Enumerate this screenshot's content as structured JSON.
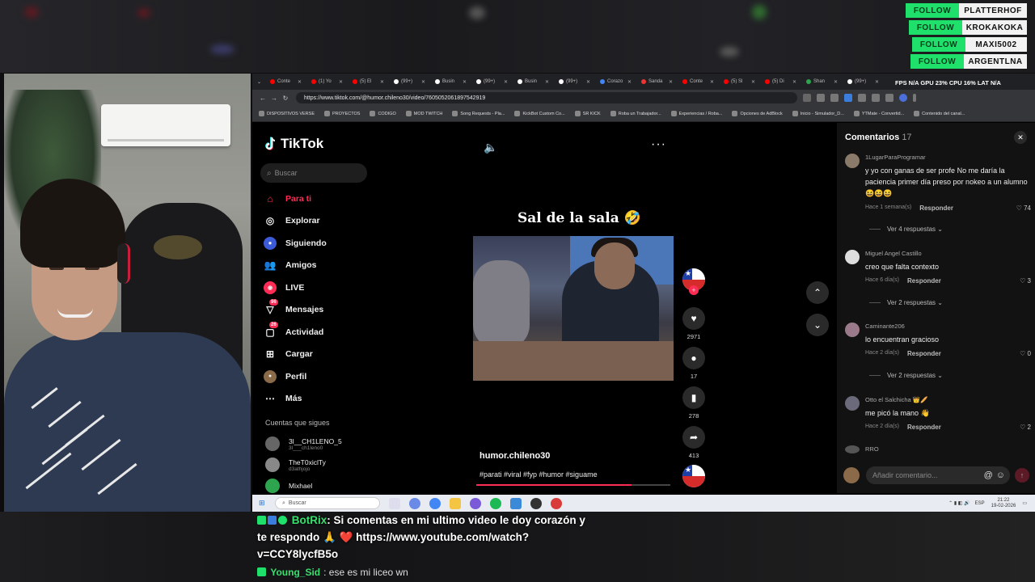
{
  "follows": [
    {
      "tag": "FOLLOW",
      "name": "PLATTERHOF"
    },
    {
      "tag": "FOLLOW",
      "name": "KROKAKOKA"
    },
    {
      "tag": "FOLLOW",
      "name": "MAXI5002"
    },
    {
      "tag": "FOLLOW",
      "name": "ARGENTLNA"
    }
  ],
  "overlay": {
    "system_stats": "FPS N/A   GPU 23%   CPU 16%   LAT N/A"
  },
  "browser": {
    "tabs": [
      "Conte",
      "(1) Yo",
      "(5) El",
      "(99+)",
      "Busin",
      "(99+)",
      "Busin",
      "(99+)",
      "Corazo",
      "Sanda",
      "Conte",
      "(5) Sl",
      "(5) Di",
      "Shan",
      "(99+)"
    ],
    "url": "https://www.tiktok.com/@humor.chileno30/video/7605052061897542919",
    "bookmarks": [
      "DISPOSITIVOS VERSE",
      "PROYECTOS",
      "CODIGO",
      "MOD TWITCH",
      "Song Requests - Pla...",
      "KickBot Custom Co...",
      "SR KICK",
      "Roba un Trabajador...",
      "Experiencias / Roba...",
      "Opciones de AdBlock",
      "Inicio - Simulador_D...",
      "YTMate - Convertid...",
      "Contenido del canal..."
    ]
  },
  "tiktok": {
    "logo": "TikTok",
    "search_placeholder": "Buscar",
    "nav": [
      {
        "label": "Para ti"
      },
      {
        "label": "Explorar"
      },
      {
        "label": "Siguiendo"
      },
      {
        "label": "Amigos"
      },
      {
        "label": "LIVE"
      },
      {
        "label": "Mensajes",
        "badge": "96"
      },
      {
        "label": "Actividad",
        "badge": "26"
      },
      {
        "label": "Cargar"
      },
      {
        "label": "Perfil"
      },
      {
        "label": "Más"
      }
    ],
    "following_title": "Cuentas que sigues",
    "following": [
      {
        "name": "3l__CH1LENO_5",
        "handle": "3l___ch1leno0"
      },
      {
        "name": "TheT0xiclTy",
        "handle": "d3athjojo"
      },
      {
        "name": "Mixhael"
      }
    ]
  },
  "video": {
    "title": "Sal de la sala 🤣",
    "author": "humor.chileno30",
    "hashtags": "#parati #viral #fyp #humor #siguame",
    "likes": "2971",
    "comments": "17",
    "saves": "278",
    "shares": "413",
    "progress": 0.8
  },
  "comments": {
    "title": "Comentarios",
    "count": "17",
    "reply_label": "Responder",
    "input_placeholder": "Añadir comentario...",
    "items": [
      {
        "user": "1LugarParaProgramar",
        "text": "y yo con ganas de ser profe No me daría la paciencia primer día preso por nokeo a un alumno 😆😆😆",
        "time": "Hace 1 semana(s)",
        "likes": "74",
        "replies": "Ver 4 respuestas ⌄"
      },
      {
        "user": "Miguel Angel Castillo",
        "text": "creo que falta contexto",
        "time": "Hace 6 día(s)",
        "likes": "3",
        "replies": "Ver 2 respuestas ⌄"
      },
      {
        "user": "Caminante206",
        "text": "lo encuentran gracioso",
        "time": "Hace 2 día(s)",
        "likes": "0",
        "replies": "Ver 2 respuestas ⌄"
      },
      {
        "user": "Otto el Salchicha 👑🥖",
        "text": "me picó la mano 👋",
        "time": "Hace 2 día(s)",
        "likes": "2"
      },
      {
        "user": "RRO"
      }
    ]
  },
  "taskbar": {
    "search": "Buscar",
    "lang": "ESP",
    "time": "21:22",
    "date": "19-02-2026"
  },
  "chat": [
    {
      "user": "BotRix",
      "text": "Si comentas en mi ultimo video le doy corazón y te respondo 🙏 ❤️ https://www.youtube.com/watch?v=CCY8lycfB5o"
    },
    {
      "user": "Young_Sid",
      "text": "ese es mi liceo wn"
    }
  ]
}
